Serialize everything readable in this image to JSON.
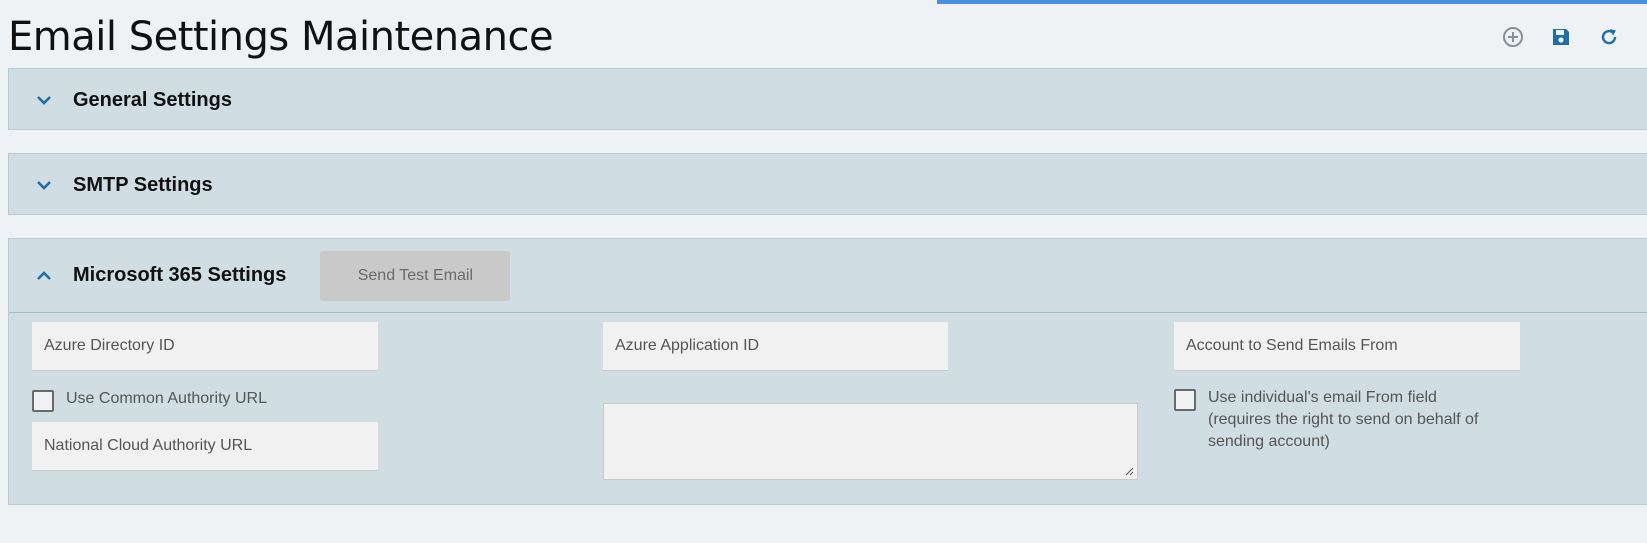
{
  "page": {
    "title": "Email Settings Maintenance"
  },
  "toolbar": {
    "add_icon": "plus-circle-icon",
    "save_icon": "floppy-disk-icon",
    "refresh_icon": "refresh-icon"
  },
  "panels": {
    "general": {
      "title": "General Settings",
      "state": "collapsed"
    },
    "smtp": {
      "title": "SMTP Settings",
      "state": "collapsed"
    },
    "ms365": {
      "title": "Microsoft 365 Settings",
      "state": "expanded",
      "send_test_label": "Send Test Email",
      "azure_directory_id": {
        "placeholder": "Azure Directory ID",
        "value": ""
      },
      "use_common_authority": {
        "label": "Use Common Authority URL",
        "checked": false
      },
      "national_cloud_url": {
        "placeholder": "National Cloud Authority URL",
        "value": ""
      },
      "azure_application_id": {
        "placeholder": "Azure Application ID",
        "value": ""
      },
      "notes": {
        "value": ""
      },
      "account_from": {
        "placeholder": "Account to Send Emails From",
        "value": ""
      },
      "use_individual_from": {
        "label_line1": "Use individual's email From field",
        "label_line2": "(requires the right to send on behalf of",
        "label_line3": "sending account)",
        "checked": false
      }
    }
  },
  "colors": {
    "accent": "#1f6ea6",
    "panel_bg": "#d0dee3",
    "progress": "#4a8ee0",
    "button_disabled": "#c9c9c9"
  }
}
